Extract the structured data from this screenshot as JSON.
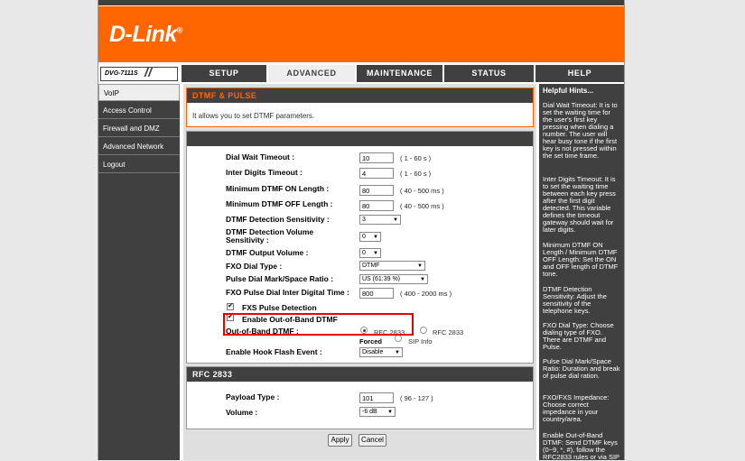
{
  "brand": {
    "logo": "D-Link",
    "model": "DVG-7111S"
  },
  "tabs": [
    {
      "label": "SETUP"
    },
    {
      "label": "ADVANCED"
    },
    {
      "label": "MAINTENANCE"
    },
    {
      "label": "STATUS"
    },
    {
      "label": "HELP"
    }
  ],
  "sidebar": {
    "items": [
      {
        "label": "VoIP"
      },
      {
        "label": "Access Control"
      },
      {
        "label": "Firewall and DMZ"
      },
      {
        "label": "Advanced Network"
      },
      {
        "label": "Logout"
      }
    ]
  },
  "dtmf": {
    "title": "DTMF & PULSE",
    "description": "It allows you to set DTMF parameters.",
    "fields": {
      "dial_wait": {
        "label": "Dial Wait Timeout :",
        "value": "10",
        "hint": "( 1 - 60 s )"
      },
      "inter_digits": {
        "label": "Inter Digits Timeout :",
        "value": "4",
        "hint": "( 1 - 60 s )"
      },
      "min_on": {
        "label": "Minimum DTMF ON Length :",
        "value": "80",
        "hint": "( 40 - 500 ms )"
      },
      "min_off": {
        "label": "Minimum DTMF OFF Length :",
        "value": "80",
        "hint": "( 40 - 500 ms )"
      },
      "sensitivity": {
        "label": "DTMF Detection Sensitivity :",
        "value": "3"
      },
      "det_volume": {
        "label_line1": "DTMF Detection Volume",
        "label_line2": "Sensitivity :",
        "value": "0"
      },
      "out_volume": {
        "label": "DTMF Output Volume :",
        "value": "0"
      },
      "fxo_dial_type": {
        "label": "FXO Dial Type :",
        "value": "DTMF"
      },
      "pulse_ratio": {
        "label": "Pulse Dial Mark/Space Ratio :",
        "value": "US (61:39 %)"
      },
      "pulse_inter": {
        "label": "FXO Pulse Dial Inter Digital Time :",
        "value": "800",
        "hint": "( 400 - 2000 ms )"
      },
      "fxs_pulse": {
        "label": "FXS Pulse Detection",
        "checked": true
      },
      "oob_enable": {
        "label": "Enable Out-of-Band DTMF",
        "checked": true
      },
      "oob": {
        "label": "Out-of-Band DTMF :",
        "opt1_a": "RFC 2833",
        "opt1_b": "Forced",
        "opt2_a": "RFC 2833",
        "opt2_b": "SIP Info"
      },
      "hook_flash": {
        "label": "Enable Hook Flash Event :",
        "value": "Disable"
      }
    }
  },
  "rfc2833": {
    "title": "RFC 2833",
    "payload": {
      "label": "Payload Type :",
      "value": "101",
      "hint": "( 96 - 127 )"
    },
    "volume": {
      "label": "Volume :",
      "value": "-6 dB"
    }
  },
  "buttons": {
    "apply": "Apply",
    "cancel": "Cancel"
  },
  "help": {
    "title": "Helpful Hints...",
    "paragraphs": [
      "Dial Wait Timeout: It is to set the waiting time for the user's first key pressing when dialing a number. The user will hear busy tone if the first key is not pressed within the set time frame.",
      "Inter Digits Timeout: It is to set the waiting time between each key press after the first digit detected. This variable defines the timeout gateway should wait for later digits.",
      "Minimum DTMF ON Length / Minimum DTMF OFF Length: Set the ON and OFF length of DTMF tone.",
      "DTMF Detection Sensitivity: Adjust the sensitivity of the telephone keys.",
      "FXO Dial Type: Choose dialing type of FXO. There are DTMF and Pulse.",
      "Pulse Dial Mark/Space Ratio: Duration and break of pulse dial ration.",
      "FXO/FXS Impedance: Choose correct impedance in your country/area.",
      "Enable Out-of-Band DTMF: Send DTMF keys (0~9, *, #), follow the RFC2833 rules or via SIP"
    ]
  }
}
